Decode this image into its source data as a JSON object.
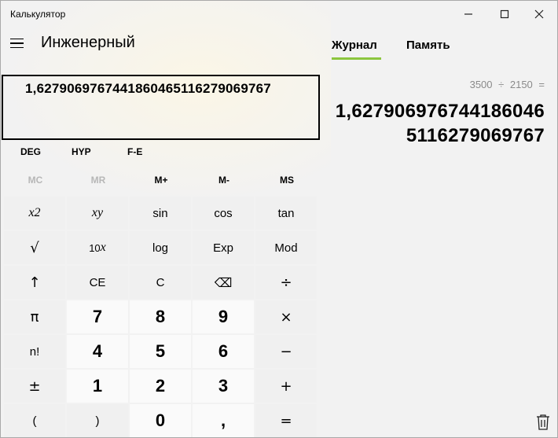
{
  "window": {
    "title": "Калькулятор"
  },
  "header": {
    "mode_title": "Инженерный"
  },
  "tabs": [
    {
      "label": "Журнал",
      "active": true
    },
    {
      "label": "Память",
      "active": false
    }
  ],
  "display": {
    "value": "1,6279069767441860465116279069767"
  },
  "history": {
    "expression": "3500  ÷  2150 =",
    "result_line1": "1,627906976744186046",
    "result_line2": "5116279069767"
  },
  "modes": {
    "deg": "DEG",
    "hyp": "HYP",
    "fe": "F-E"
  },
  "memory": {
    "mc": "MC",
    "mr": "MR",
    "mplus": "M+",
    "mminus": "M-",
    "ms": "MS"
  },
  "keys": {
    "x2_base": "x",
    "x2_exp": "2",
    "xy_base": "x",
    "xy_exp": "y",
    "sin": "sin",
    "cos": "cos",
    "tan": "tan",
    "sqrt": "√",
    "ten_base": "10",
    "ten_exp": "x",
    "log": "log",
    "exp": "Exp",
    "mod": "Mod",
    "shift": "↑",
    "ce": "CE",
    "c": "C",
    "backspace": "⌫",
    "divide": "÷",
    "pi": "π",
    "seven": "7",
    "eight": "8",
    "nine": "9",
    "multiply": "×",
    "fact": "n!",
    "four": "4",
    "five": "5",
    "six": "6",
    "minus": "−",
    "negate": "±",
    "one": "1",
    "two": "2",
    "three": "3",
    "plus": "+",
    "lparen": "(",
    "rparen": ")",
    "zero": "0",
    "comma": ",",
    "equals": "="
  },
  "colors": {
    "accent": "#8cc63f",
    "disabled": "#b7b7b7"
  }
}
